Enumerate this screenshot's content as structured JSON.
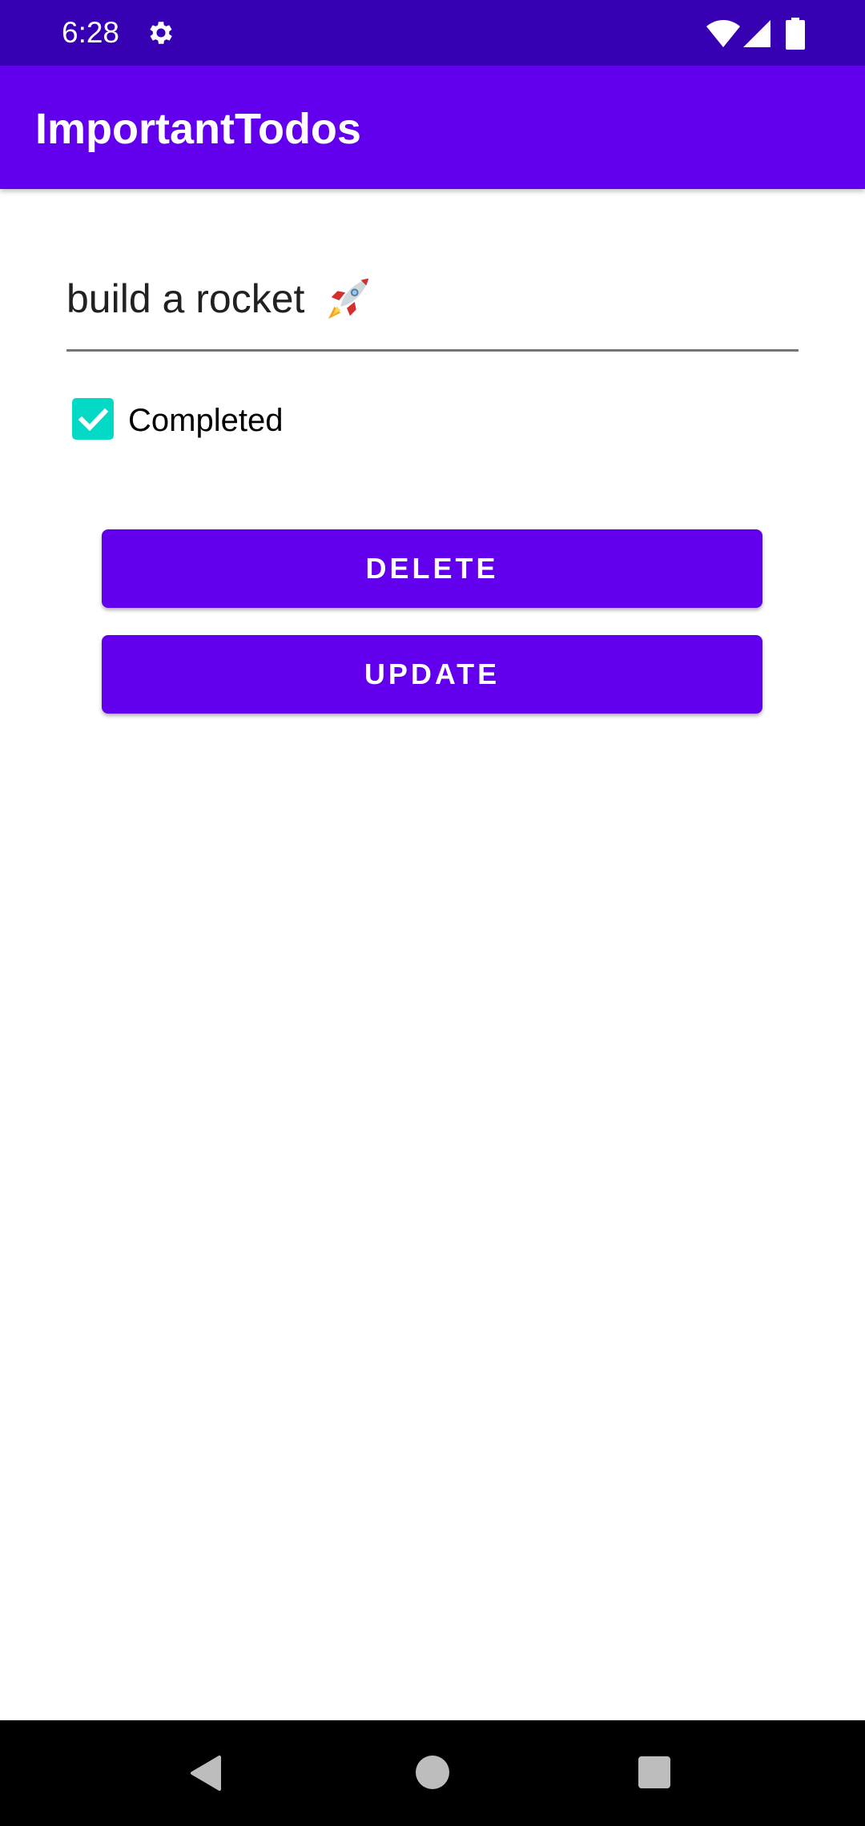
{
  "status_bar": {
    "time": "6:28",
    "icons": [
      "gear-icon",
      "wifi-icon",
      "signal-icon",
      "battery-icon"
    ],
    "background": "#3700b3"
  },
  "app_bar": {
    "title": "ImportantTodos",
    "background": "#6200ee"
  },
  "todo": {
    "text": "build a rocket",
    "emoji_icon": "rocket-icon",
    "completed": true
  },
  "checkbox": {
    "label": "Completed",
    "checked_color": "#03dac5"
  },
  "buttons": {
    "delete_label": "DELETE",
    "update_label": "UPDATE",
    "color": "#6200ee"
  },
  "nav_bar": {
    "icons": [
      "back-icon",
      "home-icon",
      "recents-icon"
    ]
  }
}
